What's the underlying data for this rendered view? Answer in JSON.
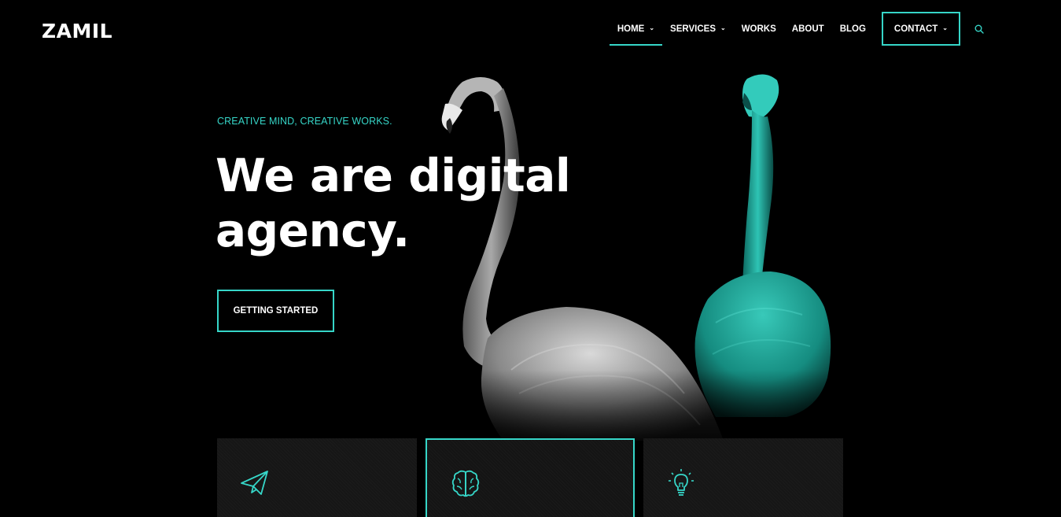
{
  "brand": {
    "logo": "ZAMIL",
    "accent": "#36d6c8"
  },
  "nav": {
    "items": [
      {
        "label": "HOME",
        "dropdown": true,
        "active": true
      },
      {
        "label": "SERVICES",
        "dropdown": true,
        "active": false
      },
      {
        "label": "WORKS",
        "dropdown": false,
        "active": false
      },
      {
        "label": "ABOUT",
        "dropdown": false,
        "active": false
      },
      {
        "label": "BLOG",
        "dropdown": false,
        "active": false
      },
      {
        "label": "CONTACT",
        "dropdown": true,
        "active": false
      }
    ],
    "search_icon": "search-icon"
  },
  "hero": {
    "eyebrow": "CREATIVE MIND, CREATIVE WORKS.",
    "headline_line1": "We are digital",
    "headline_line2": "agency.",
    "cta_label": "GETTING STARTED"
  },
  "features": {
    "cards": [
      {
        "icon": "paper-plane-icon",
        "featured": false
      },
      {
        "icon": "brain-icon",
        "featured": true
      },
      {
        "icon": "lightbulb-icon",
        "featured": false
      }
    ]
  }
}
